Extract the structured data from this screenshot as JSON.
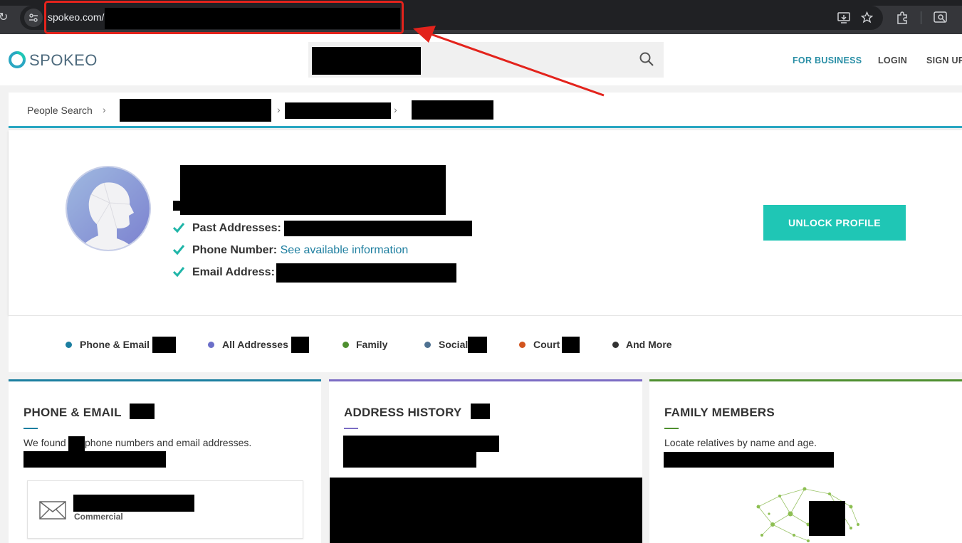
{
  "browser": {
    "url": "spokeo.com/"
  },
  "header": {
    "logo_text": "SPOKEO",
    "nav": {
      "business": "FOR BUSINESS",
      "login": "LOGIN",
      "signup": "SIGN UP"
    }
  },
  "breadcrumb": {
    "root": "People Search"
  },
  "profile": {
    "past_addresses_label": "Past Addresses:",
    "phone_label": "Phone Number:",
    "phone_link": "See available information",
    "email_label": "Email Address:",
    "unlock_button": "UNLOCK PROFILE"
  },
  "categories": [
    {
      "label": "Phone & Email",
      "color": "#1b7ea0"
    },
    {
      "label": "All Addresses",
      "color": "#6b6fc9"
    },
    {
      "label": "Family",
      "color": "#4e8f2f"
    },
    {
      "label": "Social",
      "color": "#4e7191"
    },
    {
      "label": "Court",
      "color": "#d2541e"
    },
    {
      "label": "And More",
      "color": "#333333"
    }
  ],
  "cards": {
    "phone": {
      "title": "PHONE & EMAIL",
      "desc_before": "We found",
      "desc_after": "phone numbers and email addresses.",
      "email_item_sub": "Commercial"
    },
    "address": {
      "title": "ADDRESS HISTORY"
    },
    "family": {
      "title": "FAMILY MEMBERS",
      "desc": "Locate relatives by name and age."
    }
  },
  "colors": {
    "accent_teal": "#1fc6b5",
    "breadcrumb_rule": "#2aa7c2",
    "highlight_red": "#e3231c"
  }
}
